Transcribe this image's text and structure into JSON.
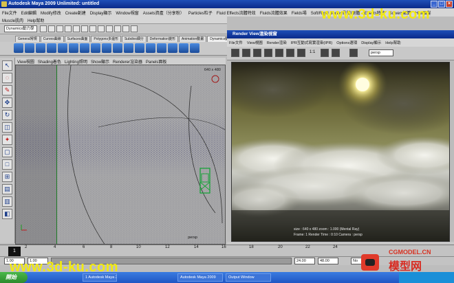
{
  "maya": {
    "title": "Autodesk Maya 2009 Unlimited: untitled",
    "menus": [
      "File文件",
      "Edit編輯",
      "Modify修改",
      "Create創建",
      "Display顯示",
      "Window視窗",
      "Assets資產（分享粉）",
      "Particles粒子",
      "Fluid Effects流體特效",
      "Fluids流體效果",
      "Fields場",
      "Soft/Rigid Bodies柔體/剛體",
      "Effects特效",
      "Solvers解算",
      "Hair頭髮"
    ],
    "menus_row2": [
      "Muscle肌肉",
      "Help幫助"
    ],
    "mode_select": "Dynamics動力學",
    "shelf_tabs": [
      "General常規",
      "Curves曲線",
      "Surfaces曲面",
      "Polygons多邊形",
      "Subdivs細分",
      "Deformation變形",
      "Animation動畫",
      "Dynamics動力學"
    ],
    "panel_menu": [
      "View視圖",
      "Shading着色",
      "Lighting照明",
      "Show顯示",
      "Renderer渲染器",
      "Panels面板"
    ],
    "resolution": "640 x 480",
    "camera": "persp"
  },
  "timeline": {
    "current_frame": "1",
    "ticks": [
      "2",
      "4",
      "6",
      "8",
      "10",
      "12",
      "14",
      "16",
      "18",
      "20",
      "22",
      "24"
    ],
    "start": "1.00",
    "range_start": "1.00",
    "range_end": "24.00",
    "end": "48.00",
    "char_set": "No"
  },
  "render_view": {
    "title": "Render View渲染視窗",
    "menus": [
      "File文件",
      "View視圖",
      "Render渲染",
      "IPR互動式寫實渲染(IPR)",
      "Options選項",
      "Display顯示",
      "Help幫助"
    ],
    "ratio": "1:1",
    "camera": "persp",
    "info_line1": "size : 640 x 480 zoom : 1.000   (Mental Ray)",
    "info_line2": "Frame: 1   Render Time : 0:10   Camera : persp"
  },
  "taskbar": {
    "start": "開始",
    "items": [
      "1 Autodesk Maya 2009",
      "Autodesk Maya 2009",
      "Output Window"
    ]
  },
  "watermarks": {
    "top": "www.3d-ku.com",
    "bottom": "www.3d-ku.com",
    "logo_small": "CGMODEL.CN",
    "logo_big": "模型网"
  },
  "colors": {
    "title_bar": "#0a2a8a",
    "watermark": "#f2ea10",
    "sun": "#fffbd0"
  }
}
